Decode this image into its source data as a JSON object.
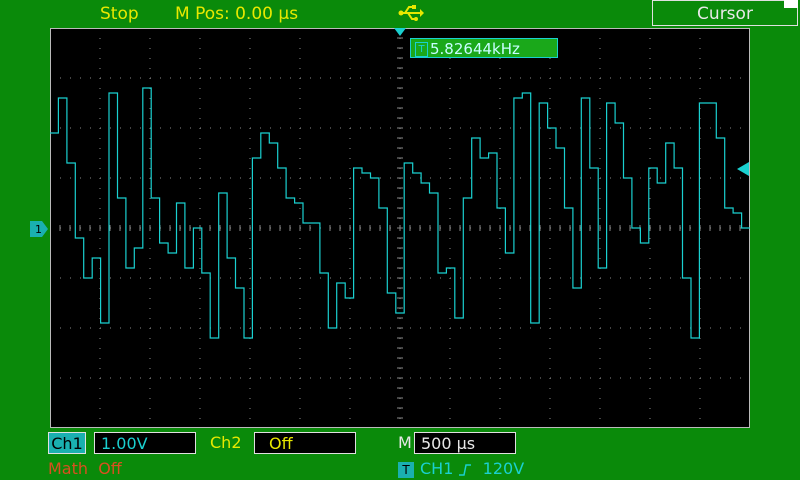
{
  "header": {
    "status": "Stop",
    "mpos_label": "M Pos:",
    "mpos_value": "0.00",
    "mpos_unit": "µs",
    "usb_icon": "usb-icon",
    "menu_label": "Cursor"
  },
  "display": {
    "frequency_marker": "T",
    "frequency": "5.82644kHz",
    "channel_marker": "1"
  },
  "footer": {
    "ch1_label": "Ch1",
    "ch1_scale": "1.00V",
    "ch2_label": "Ch2",
    "ch2_state": "Off",
    "timebase_label": "M",
    "timebase_value": "500 µs",
    "math_label": "Math",
    "math_state": "Off",
    "trigger_marker": "T",
    "trigger_source": "CH1",
    "trigger_slope_icon": "rising-edge-icon",
    "trigger_level": "120V"
  },
  "colors": {
    "background": "#0a8a0a",
    "screen": "#000000",
    "trace": "#1ad0d0",
    "label_yellow": "#e8e800",
    "math_red": "#d85020"
  },
  "waveform": {
    "volts_per_div": 1.0,
    "time_per_div_us": 500,
    "levels_div": [
      1.9,
      2.6,
      1.3,
      -0.2,
      -1.0,
      -0.6,
      -1.9,
      2.7,
      0.6,
      -0.8,
      -0.4,
      2.8,
      0.6,
      -0.3,
      -0.5,
      0.5,
      -0.8,
      0.0,
      -0.9,
      -2.2,
      0.7,
      -0.6,
      -1.2,
      -2.2,
      1.4,
      1.9,
      1.7,
      1.2,
      0.6,
      0.5,
      0.1,
      0.1,
      -0.9,
      -2.0,
      -1.1,
      -1.4,
      1.2,
      1.1,
      1.0,
      0.4,
      -1.3,
      -1.7,
      1.3,
      1.1,
      0.9,
      0.7,
      -0.9,
      -0.8,
      -1.8,
      0.6,
      1.8,
      1.4,
      1.5,
      0.4,
      -0.5,
      2.6,
      2.7,
      -1.9,
      2.5,
      2.0,
      1.6,
      0.4,
      -1.2,
      2.6,
      1.2,
      -0.8,
      2.5,
      2.1,
      1.0,
      0.0,
      -0.3,
      1.2,
      0.9,
      1.7,
      1.2,
      -1.0,
      -2.2,
      2.5,
      2.5,
      1.8,
      0.4,
      0.3,
      0.0
    ]
  }
}
